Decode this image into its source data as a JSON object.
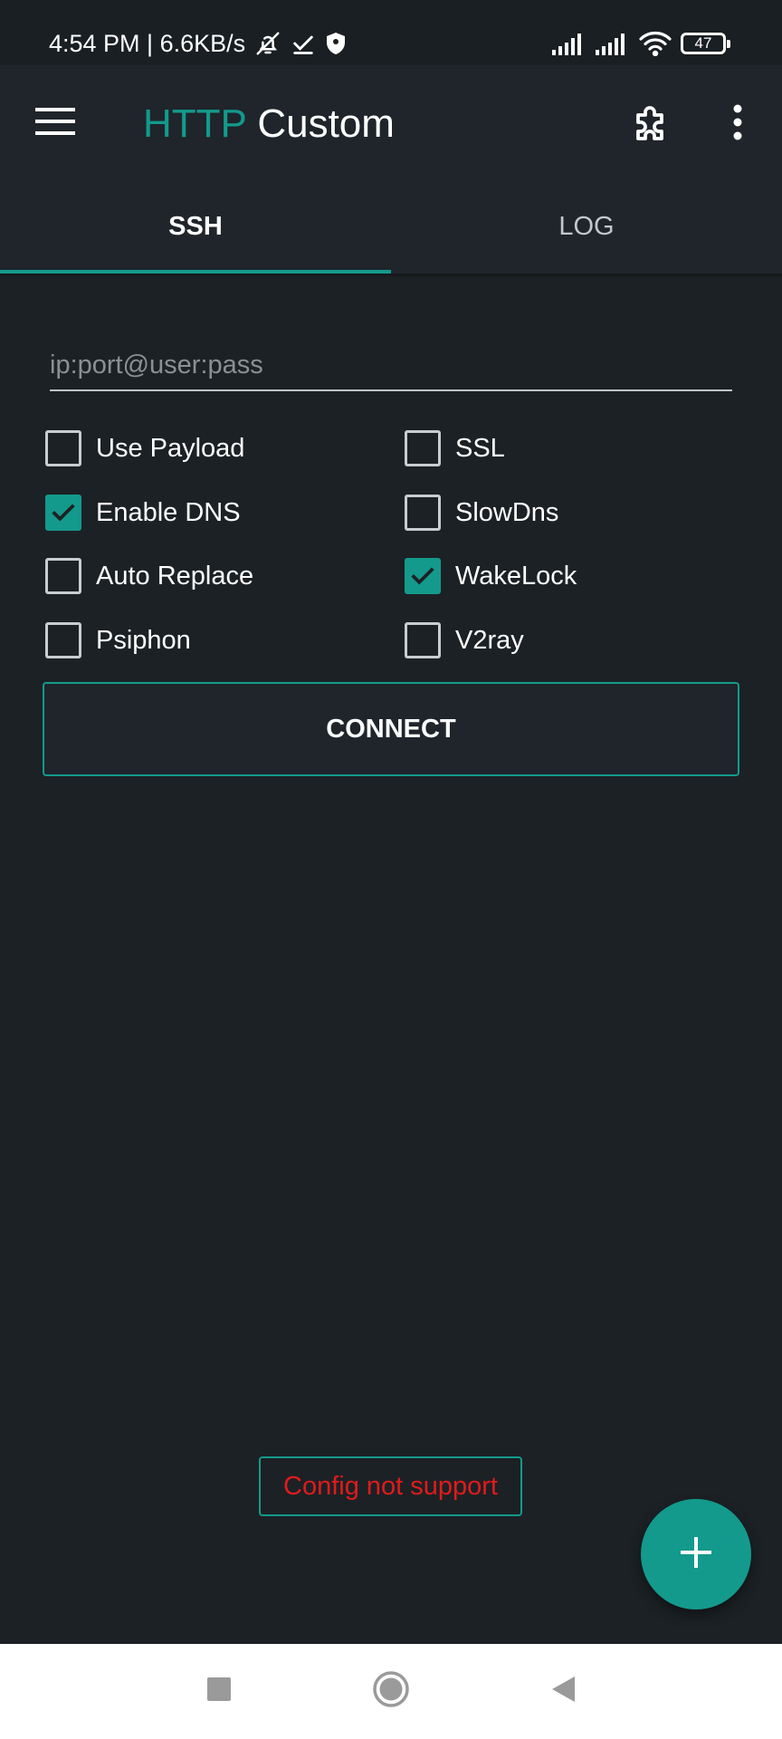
{
  "status_bar": {
    "time_speed": "4:54 PM | 6.6KB/s",
    "battery_level": "47"
  },
  "app_bar": {
    "title_accent": "HTTP",
    "title_rest": "Custom"
  },
  "tabs": [
    {
      "label": "SSH",
      "active": true
    },
    {
      "label": "LOG",
      "active": false
    }
  ],
  "host_input": {
    "value": "",
    "placeholder": "ip:port@user:pass"
  },
  "options": [
    {
      "label": "Use Payload",
      "checked": false
    },
    {
      "label": "SSL",
      "checked": false
    },
    {
      "label": "Enable DNS",
      "checked": true
    },
    {
      "label": "SlowDns",
      "checked": false
    },
    {
      "label": "Auto Replace",
      "checked": false
    },
    {
      "label": "WakeLock",
      "checked": true
    },
    {
      "label": "Psiphon",
      "checked": false
    },
    {
      "label": "V2ray",
      "checked": false
    }
  ],
  "connect_button": {
    "label": "CONNECT"
  },
  "toast": {
    "message": "Config not support"
  },
  "colors": {
    "accent": "#139a8c",
    "background": "#1c2125",
    "toolbar": "#1f252b",
    "error_text": "#e01b1b"
  },
  "icons": {
    "menu": "hamburger-menu-icon",
    "plugin": "puzzle-piece-icon",
    "more": "more-vertical-icon",
    "fab": "plus-icon"
  }
}
